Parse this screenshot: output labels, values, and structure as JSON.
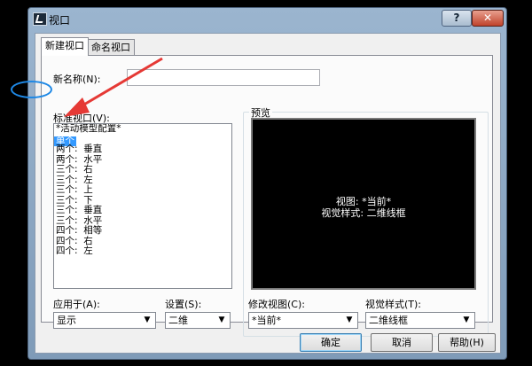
{
  "window": {
    "title": "视口",
    "help_glyph": "?",
    "close_glyph": "✕"
  },
  "tabs": [
    {
      "label": "新建视口"
    },
    {
      "label": "命名视口"
    }
  ],
  "new_name": {
    "label": "新名称(N):",
    "value": ""
  },
  "standard": {
    "label": "标准视口(V):",
    "items": [
      "*活动模型配置*",
      "单个",
      "两个:  垂直",
      "两个:  水平",
      "三个:  右",
      "三个:  左",
      "三个:  上",
      "三个:  下",
      "三个:  垂直",
      "三个:  水平",
      "四个:  相等",
      "四个:  右",
      "四个:  左"
    ],
    "selected_index": 1
  },
  "preview": {
    "label": "预览",
    "line1": "视图: *当前*",
    "line2": "视觉样式: 二维线框"
  },
  "apply_to": {
    "label": "应用于(A):",
    "value": "显示"
  },
  "setup": {
    "label": "设置(S):",
    "value": "二维"
  },
  "change_view": {
    "label": "修改视图(C):",
    "value": "*当前*"
  },
  "visual_style": {
    "label": "视觉样式(T):",
    "value": "二维线框"
  },
  "buttons": {
    "ok": "确定",
    "cancel": "取消",
    "help": "帮助(H)"
  },
  "annotation_color": "#e53935"
}
